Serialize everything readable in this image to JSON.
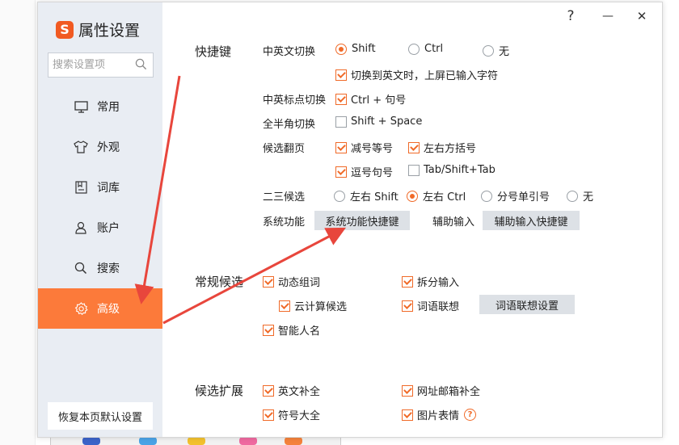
{
  "app": {
    "title": "属性设置",
    "logo_letter": "S"
  },
  "titlebar": {
    "help": "?",
    "minimize": "—",
    "close": "✕"
  },
  "search": {
    "placeholder": "搜索设置项",
    "value": ""
  },
  "sidebar": {
    "items": [
      {
        "label": "常用",
        "icon": "monitor-icon",
        "active": false
      },
      {
        "label": "外观",
        "icon": "shirt-icon",
        "active": false
      },
      {
        "label": "词库",
        "icon": "book-icon",
        "active": false
      },
      {
        "label": "账户",
        "icon": "user-icon",
        "active": false
      },
      {
        "label": "搜索",
        "icon": "search-icon",
        "active": false
      },
      {
        "label": "高级",
        "icon": "gear-icon",
        "active": true
      }
    ],
    "reset_label": "恢复本页默认设置"
  },
  "shortcuts": {
    "title": "快捷键",
    "cn_en_switch": {
      "label": "中英文切换",
      "options": [
        {
          "label": "Shift",
          "checked": true
        },
        {
          "label": "Ctrl",
          "checked": false
        },
        {
          "label": "无",
          "checked": false
        }
      ],
      "commit_on_switch": {
        "label": "切换到英文时，上屏已输入字符",
        "checked": true
      }
    },
    "punct_switch": {
      "label": "中英标点切换",
      "option": {
        "label": "Ctrl + 句号",
        "checked": true
      }
    },
    "width_switch": {
      "label": "全半角切换",
      "option": {
        "label": "Shift + Space",
        "checked": false
      }
    },
    "page_flip": {
      "label": "候选翻页",
      "options": [
        {
          "label": "减号等号",
          "checked": true
        },
        {
          "label": "左右方括号",
          "checked": true
        },
        {
          "label": "逗号句号",
          "checked": true
        },
        {
          "label": "Tab/Shift+Tab",
          "checked": false
        }
      ]
    },
    "second_third": {
      "label": "二三候选",
      "options": [
        {
          "label": "左右 Shift",
          "checked": false
        },
        {
          "label": "左右 Ctrl",
          "checked": true
        },
        {
          "label": "分号单引号",
          "checked": false
        },
        {
          "label": "无",
          "checked": false
        }
      ]
    },
    "system_func": {
      "label": "系统功能",
      "button": "系统功能快捷键"
    },
    "aux_input": {
      "label": "辅助输入",
      "button": "辅助输入快捷键"
    }
  },
  "candidates": {
    "title": "常规候选",
    "dynamic_words": {
      "label": "动态组词",
      "checked": true
    },
    "cloud": {
      "label": "云计算候选",
      "checked": true
    },
    "smart_names": {
      "label": "智能人名",
      "checked": true
    },
    "split_input": {
      "label": "拆分输入",
      "checked": true
    },
    "word_assoc": {
      "label": "词语联想",
      "checked": true
    },
    "assoc_button": "词语联想设置"
  },
  "expansion": {
    "title": "候选扩展",
    "english_complete": {
      "label": "英文补全",
      "checked": true
    },
    "symbols": {
      "label": "符号大全",
      "checked": true
    },
    "url_email": {
      "label": "网址邮箱补全",
      "checked": true
    },
    "emoji": {
      "label": "图片表情",
      "checked": true
    }
  },
  "colors": {
    "accent": "#f06a28",
    "active_nav": "#fc7a3a",
    "sidebar_bg": "#e9edf3",
    "arrow": "#e8463c"
  }
}
